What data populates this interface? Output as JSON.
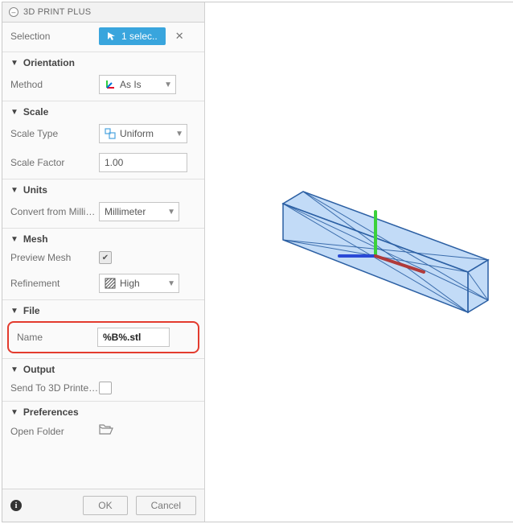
{
  "panel": {
    "title": "3D PRINT PLUS",
    "selection": {
      "label": "Selection",
      "pill": "1 selec..",
      "clear": "✕"
    },
    "orientation": {
      "title": "Orientation",
      "method_label": "Method",
      "method_value": "As Is"
    },
    "scale": {
      "title": "Scale",
      "type_label": "Scale Type",
      "type_value": "Uniform",
      "factor_label": "Scale Factor",
      "factor_value": "1.00"
    },
    "units": {
      "title": "Units",
      "convert_label": "Convert from Millim...",
      "convert_value": "Millimeter"
    },
    "mesh": {
      "title": "Mesh",
      "preview_label": "Preview Mesh",
      "preview_checked": true,
      "refine_label": "Refinement",
      "refine_value": "High"
    },
    "file": {
      "title": "File",
      "name_label": "Name",
      "name_value": "%B%.stl"
    },
    "output": {
      "title": "Output",
      "send_label": "Send To 3D Printer ..."
    },
    "prefs": {
      "title": "Preferences",
      "open_label": "Open Folder"
    },
    "footer": {
      "ok": "OK",
      "cancel": "Cancel"
    }
  }
}
